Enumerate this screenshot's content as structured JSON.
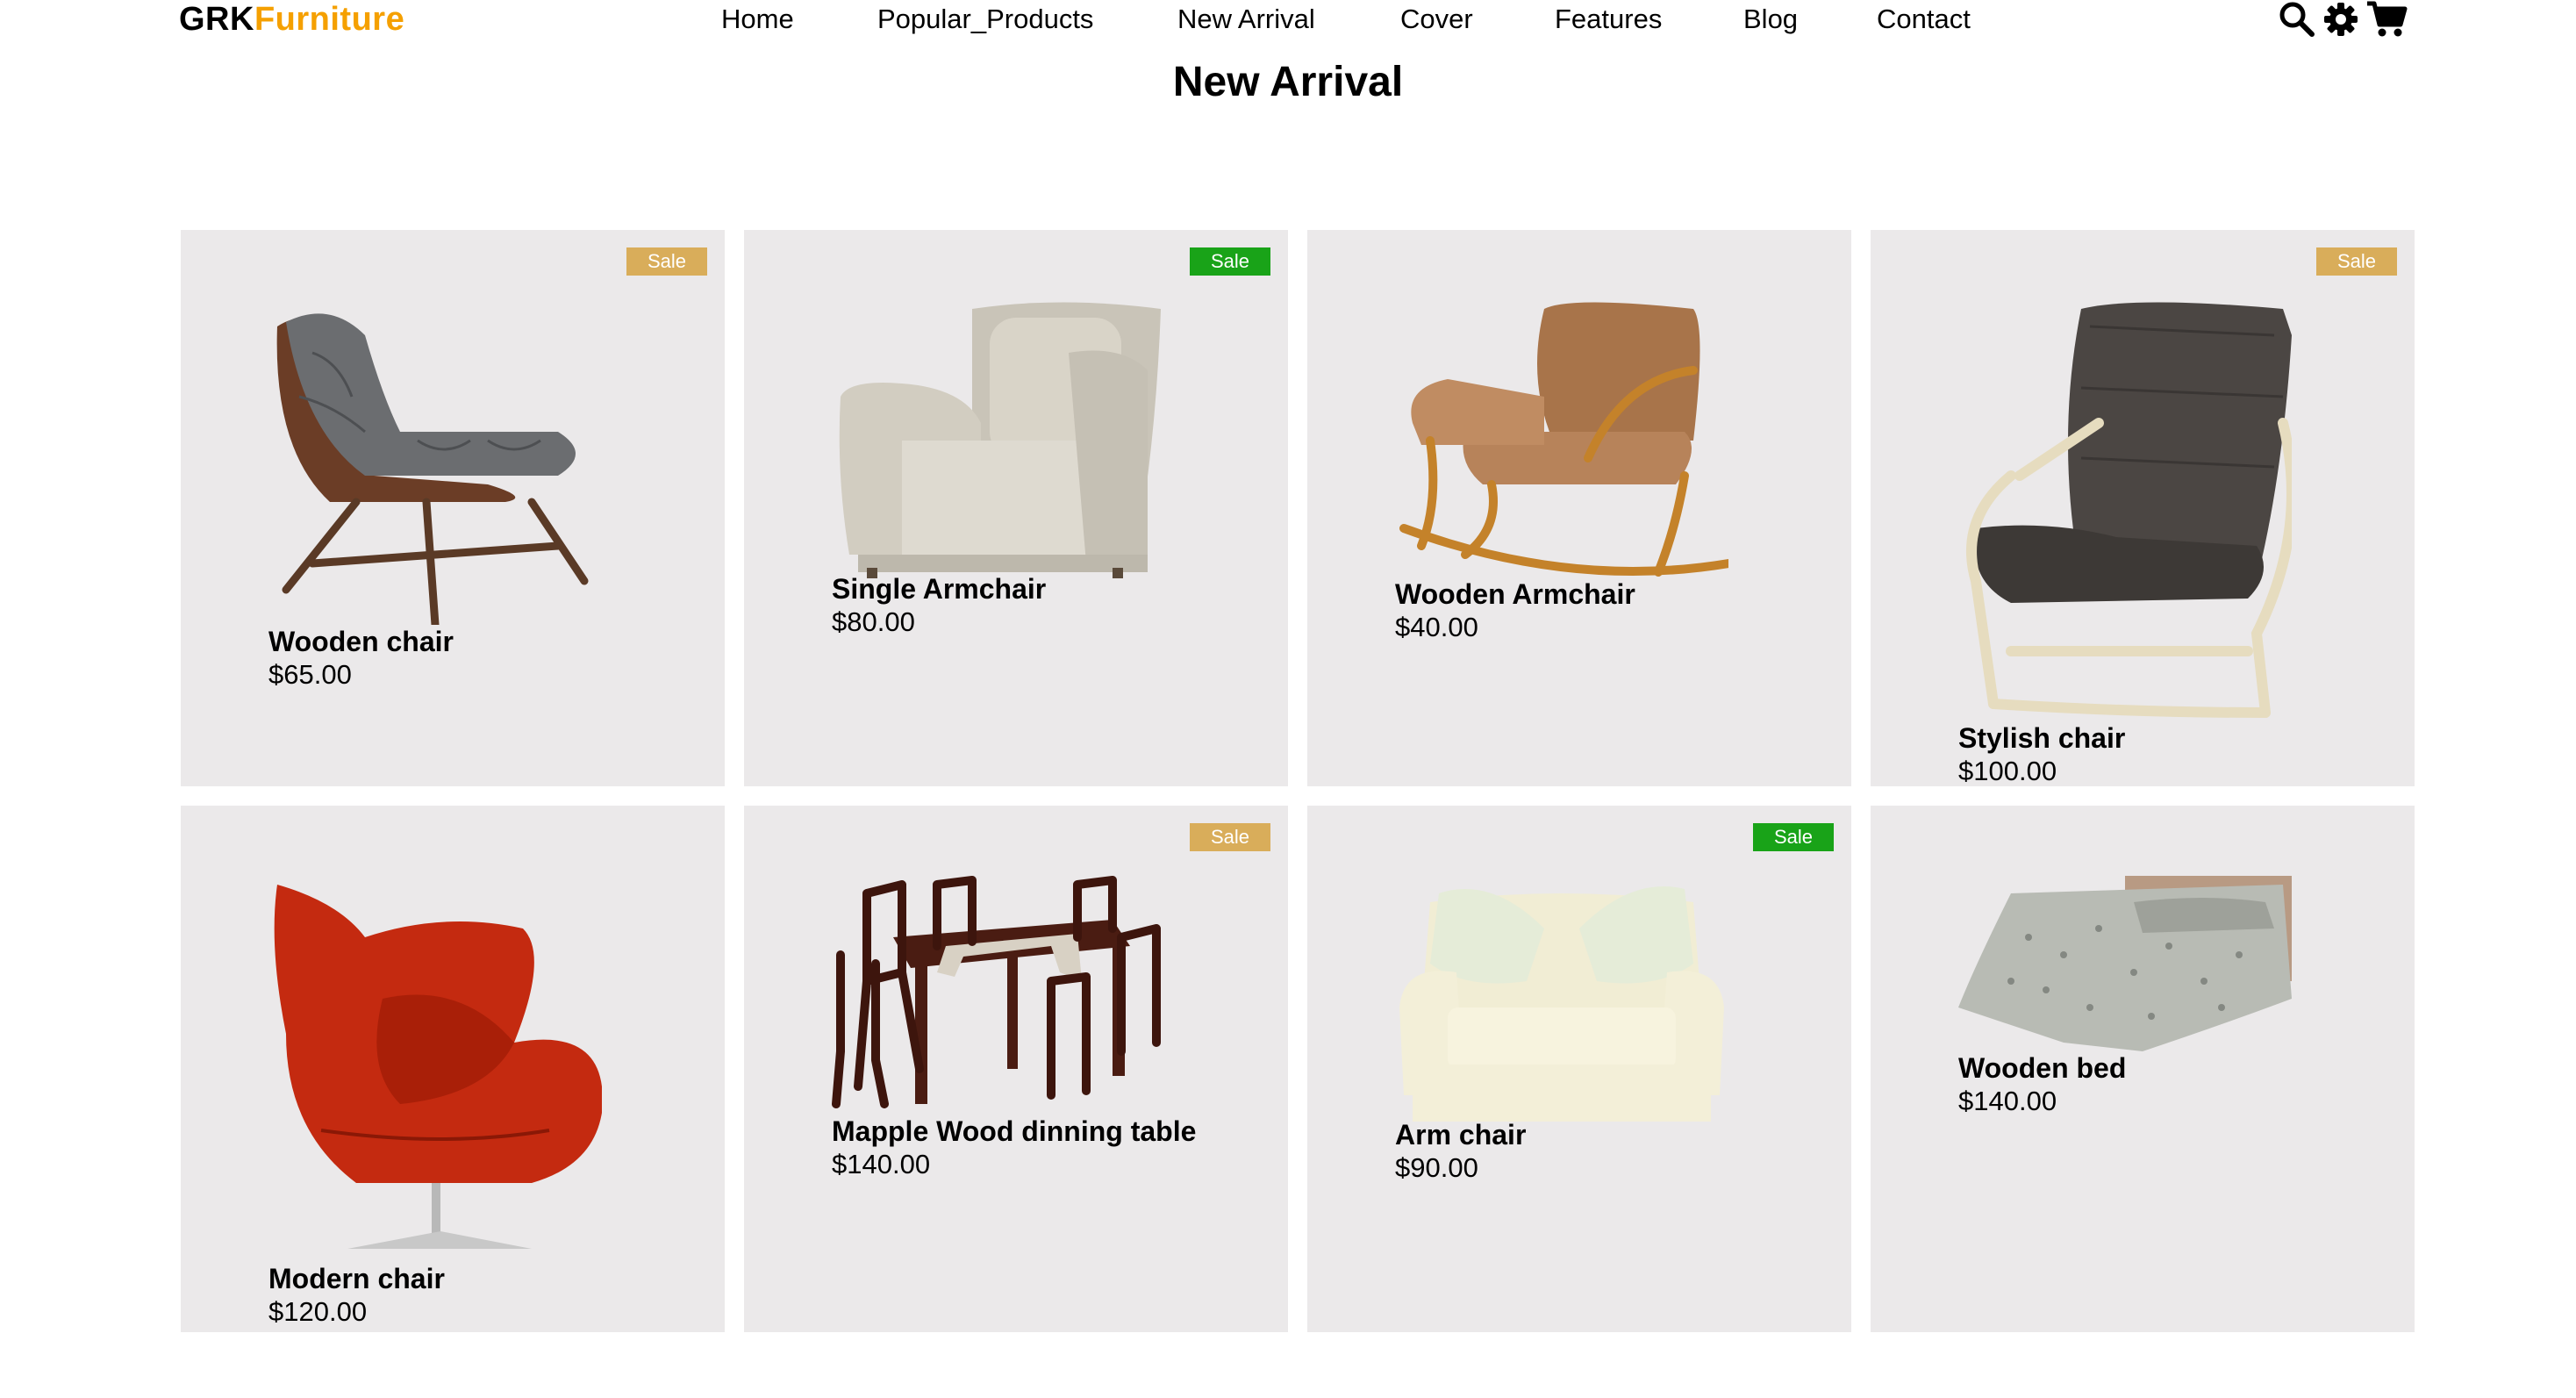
{
  "header": {
    "logo_main": "GRK",
    "logo_accent": "Furniture",
    "nav": [
      "Home",
      "Popular_Products",
      "New Arrival",
      "Cover",
      "Features",
      "Blog",
      "Contact"
    ],
    "icons": [
      "search-icon",
      "gear-icon",
      "cart-icon"
    ]
  },
  "section": {
    "title": "New Arrival"
  },
  "products": [
    {
      "name": "Wooden chair",
      "price": "$65.00",
      "badge": "Sale",
      "badge_color": "#d9ad5a"
    },
    {
      "name": "Single Armchair",
      "price": "$80.00",
      "badge": "Sale",
      "badge_color": "#19a318"
    },
    {
      "name": "Wooden Armchair",
      "price": "$40.00",
      "badge": "",
      "badge_color": ""
    },
    {
      "name": "Stylish chair",
      "price": "$100.00",
      "badge": "Sale",
      "badge_color": "#d9ad5a"
    },
    {
      "name": "Modern chair",
      "price": "$120.00",
      "badge": "",
      "badge_color": ""
    },
    {
      "name": "Mapple Wood dinning table",
      "price": "$140.00",
      "badge": "Sale",
      "badge_color": "#d9ad5a"
    },
    {
      "name": "Arm chair",
      "price": "$90.00",
      "badge": "Sale",
      "badge_color": "#19a318"
    },
    {
      "name": "Wooden bed",
      "price": "$140.00",
      "badge": "",
      "badge_color": ""
    }
  ],
  "colors": {
    "accent": "#f5a000",
    "card_bg": "#ebe9ea",
    "sale_gold": "#d9ad5a",
    "sale_green": "#19a318"
  }
}
